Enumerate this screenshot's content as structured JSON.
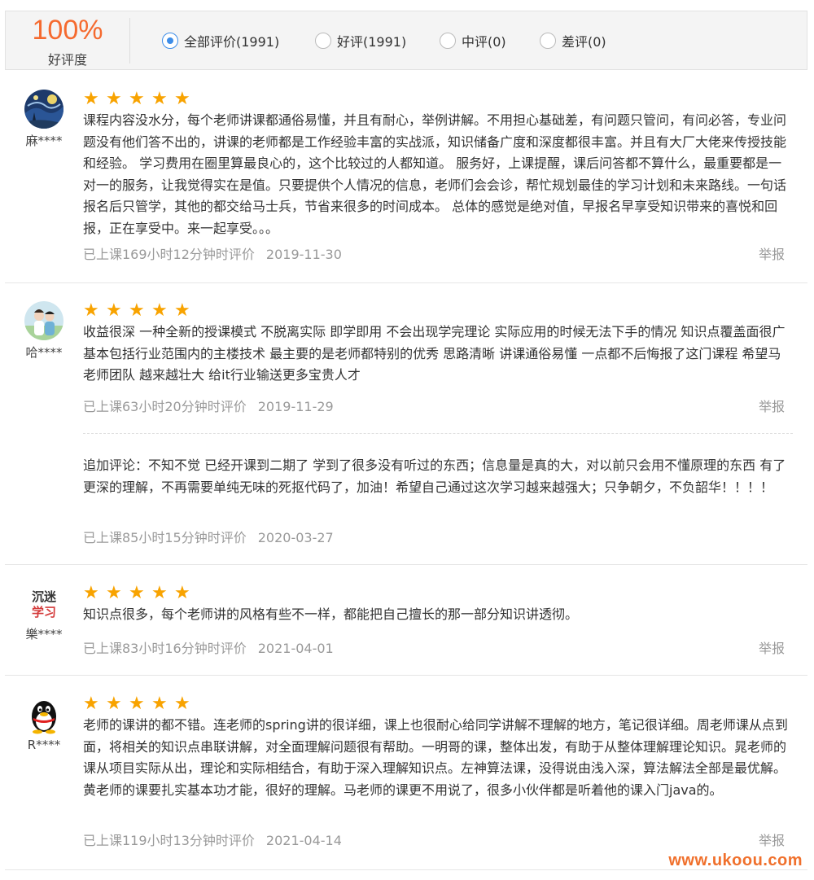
{
  "summary": {
    "rate": "100%",
    "rate_label": "好评度"
  },
  "filters": [
    {
      "label": "全部评价(1991)",
      "checked": true
    },
    {
      "label": "好评(1991)",
      "checked": false
    },
    {
      "label": "中评(0)",
      "checked": false
    },
    {
      "label": "差评(0)",
      "checked": false
    }
  ],
  "star_glyph": "★",
  "report_label": "举报",
  "reviews": [
    {
      "user": "麻****",
      "avatar": "starry-night-avatar",
      "stars": 5,
      "text": "课程内容没水分，每个老师讲课都通俗易懂，并且有耐心，举例讲解。不用担心基础差，有问题只管问，有问必答，专业问题没有他们答不出的，讲课的老师都是工作经验丰富的实战派，知识储备广度和深度都很丰富。并且有大厂大佬来传授技能和经验。 学习费用在圈里算最良心的，这个比较过的人都知道。 服务好，上课提醒，课后问答都不算什么，最重要都是一对一的服务，让我觉得实在是值。只要提供个人情况的信息，老师们会会诊，帮忙规划最佳的学习计划和未来路线。一句话报名后只管学，其他的都交给马士兵，节省来很多的时间成本。 总体的感觉是绝对值，早报名早享受知识带来的喜悦和回报，正在享受中。来一起享受。。。",
      "meta": "已上课169小时12分钟时评价",
      "date": "2019-11-30"
    },
    {
      "user": "哈****",
      "avatar": "couple-photo-avatar",
      "stars": 5,
      "text": "收益很深 一种全新的授课模式 不脱离实际 即学即用 不会出现学完理论 实际应用的时候无法下手的情况 知识点覆盖面很广 基本包括行业范围内的主楼技术 最主要的是老师都特别的优秀 思路清晰 讲课通俗易懂 一点都不后悔报了这门课程 希望马老师团队 越来越壮大 给it行业输送更多宝贵人才",
      "meta": "已上课63小时20分钟时评价",
      "date": "2019-11-29",
      "followup": {
        "text": "追加评论：不知不觉 已经开课到二期了 学到了很多没有听过的东西；信息量是真的大，对以前只会用不懂原理的东西 有了更深的理解，不再需要单纯无味的死抠代码了，加油！希望自己通过这次学习越来越强大；只争朝夕，不负韶华！！！！",
        "meta": "已上课85小时15分钟时评价",
        "date": "2020-03-27"
      }
    },
    {
      "user": "樂****",
      "avatar": "calligraphy-avatar",
      "avatar_text": [
        "沉迷",
        "学习"
      ],
      "stars": 5,
      "text": "知识点很多，每个老师讲的风格有些不一样，都能把自己擅长的那一部分知识讲透彻。",
      "meta": "已上课83小时16分钟时评价",
      "date": "2021-04-01"
    },
    {
      "user": "R****",
      "avatar": "qq-penguin-avatar",
      "stars": 5,
      "text": "老师的课讲的都不错。连老师的spring讲的很详细，课上也很耐心给同学讲解不理解的地方，笔记很详细。周老师课从点到面，将相关的知识点串联讲解，对全面理解问题很有帮助。一明哥的课，整体出发，有助于从整体理解理论知识。晁老师的课从项目实际从出，理论和实际相结合，有助于深入理解知识点。左神算法课，没得说由浅入深，算法解法全部是最优解。黄老师的课要扎实基本功才能，很好的理解。马老师的课更不用说了，很多小伙伴都是听着他的课入门java的。",
      "meta": "已上课119小时13分钟时评价",
      "date": "2021-04-14"
    }
  ],
  "watermark": "www.ukoou.com",
  "colors": {
    "accent_orange": "#f56a2f",
    "star": "#f8a300",
    "radio_selected": "#3d8de8",
    "meta_text": "#999999"
  }
}
